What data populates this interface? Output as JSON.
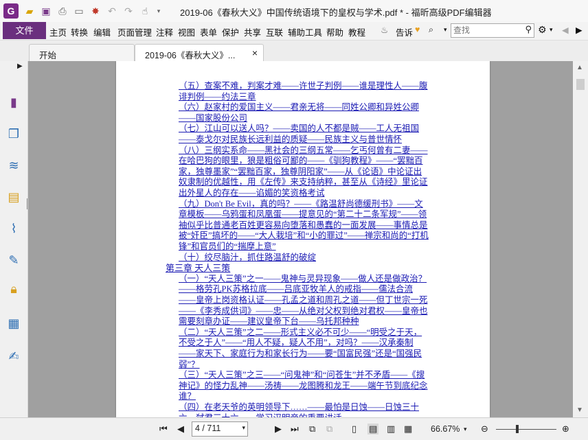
{
  "title_bar": {
    "logo_letter": "G",
    "document_title": "2019-06《春秋大义》中国传统语境下的皇权与学术.pdf * - 福昕高级PDF编辑器",
    "quick_icons": [
      "open-folder-icon",
      "save-icon",
      "print-icon",
      "new-icon",
      "stamp-icon",
      "undo-icon",
      "redo-icon",
      "hand-tool-icon",
      "dropdown-icon"
    ]
  },
  "menu": {
    "file": "文件",
    "items": [
      "主页",
      "转换",
      "编辑",
      "页面管理",
      "注释",
      "视图",
      "表单",
      "保护",
      "共享",
      "互联",
      "辅助工具",
      "帮助",
      "教程"
    ],
    "tell_me": "告诉",
    "search_placeholder": "查找"
  },
  "tabs": [
    {
      "label": "开始"
    },
    {
      "label": "2019-06《春秋大义》...",
      "close": "×"
    }
  ],
  "left_panel": [
    "page-thumbnails-icon",
    "copy-pages-icon",
    "layers-icon",
    "comments-icon",
    "attachments-icon",
    "signature-icon",
    "lock-icon",
    "form-fields-icon",
    "edit-sign-icon"
  ],
  "toc": [
    "（五）查案不难，判案才难——许世子判例——谁是理性人——腹",
    "诽判例——约法三章",
    "（六）赵家村的爱国主义——君亲无将——同姓公卿和异姓公卿",
    "——国家股份公司",
    "（七）江山可以送人吗？——卖国的人不都是贼——工人无祖国",
    "——泰戈尔对民族长远利益的质疑——民族主义与普世情怀",
    "（八）三纲实系命——黑社会的三纲五常——乞丐何曾有二妻——",
    "在哈巴狗的眼里，狼是粗俗可鄙的——《驯狗教程》——“罢黜百",
    "家，独尊墨家”“罢黜百家，独尊阴阳家”——从《论语》中论证出",
    "奴隶制的优越性，用《左传》来支持纳粹，甚至从《诗经》里论证",
    "出外星人的存在——谄媚的笑资格考试",
    "（九）Don't Be Evil，真的吗？——《路温舒尚德缓刑书》——文",
    "章模板——乌鸦蛋和凤凰蛋——提意见的“第二十二条军规”——领",
    "袖似乎比普通老百姓更容易向堕落和愚蠢的一面发展——事情总是",
    "被“奸臣”搞坏的——“大人栽培”和“小的罪过”——禅宗和尚的“打机",
    "锋”和官员们的“揣摩上意”",
    "（十）绞尽脑汁，抓住路温舒的破绽",
    "第三章 天人三策",
    "（一）“天人三策”之一——鬼神与灵异现象——做人还是做政治？",
    "——格劳孔PK苏格拉底——吕底亚牧羊人的戒指——儒法合流",
    "——皇帝上岗资格认证——孔孟之道和周孔之道——但丁世宗一死",
    "——《李秀成供词》——忠——从绝对父权到绝对君权——皇帝也",
    "需要刻章办证——建议皇帝下台——乌托邦种种",
    "（二）“天人三策”之二——形式主义必不可少——“明受之于天，",
    "不受之于人”——“用人不疑，疑人不用”，对吗？——汉承秦制",
    "——家天下、家庭行为和家长行为——要“国富民强”还是“国强民",
    "弱”？",
    "（三）“天人三策”之三——“问鬼神”和“问苍生”并不矛盾——《搜",
    "神记》的怪力乱神——汤祷——龙图腾和龙王——端午节到底纪念",
    "谁？",
    "（四）在老天爷的英明领导下……——最怕是日蚀——日蚀三十",
    "六，弑君三十六——学习汉明帝的重要讲话"
  ],
  "status": {
    "page_input": "4 / 711",
    "zoom": "66.67%",
    "zoom_fraction": 0.35
  },
  "colors": {
    "accent": "#6a2f7e",
    "link": "#1a1ab3",
    "doc_background": "#a0a0a0"
  }
}
